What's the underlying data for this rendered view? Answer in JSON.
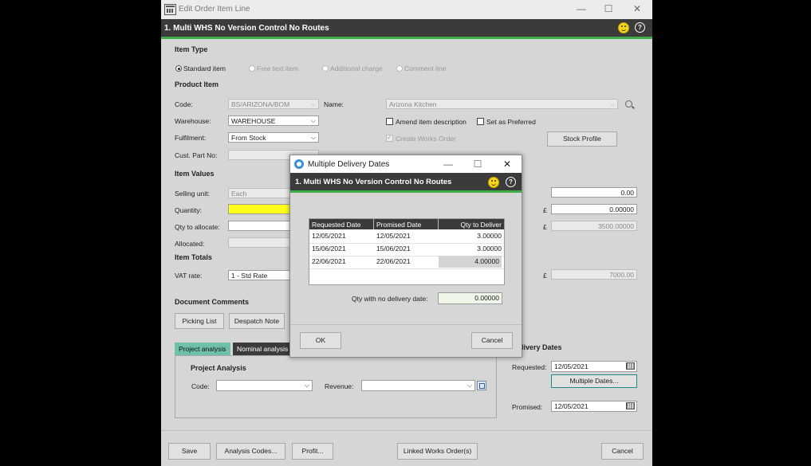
{
  "window": {
    "title": "Edit Order Item Line",
    "header": "1. Multi WHS No Version Control No Routes"
  },
  "item_type": {
    "section": "Item Type",
    "options": [
      "Standard item",
      "Free text item",
      "Additional charge",
      "Comment line"
    ]
  },
  "product_item": {
    "section": "Product Item",
    "code_label": "Code:",
    "code_value": "BS/ARIZONA/BOM",
    "name_label": "Name:",
    "name_value": "Arizona Kitchen",
    "warehouse_label": "Warehouse:",
    "warehouse_value": "WAREHOUSE",
    "fulfilment_label": "Fulfilment:",
    "fulfilment_value": "From Stock",
    "cust_part_label": "Cust. Part No:",
    "amend_label": "Amend item description",
    "preferred_label": "Set as Preferred",
    "works_order_label": "Create Works Order",
    "stock_profile_button": "Stock Profile"
  },
  "item_values": {
    "section": "Item Values",
    "selling_unit_label": "Selling unit:",
    "selling_unit_value": "Each",
    "quantity_label": "Quantity:",
    "qty_allocate_label": "Qty to allocate:",
    "allocated_label": "Allocated:",
    "currency": "£",
    "right_value_1": "0.00",
    "right_value_2": "0.00000",
    "right_value_3": "3500.00000"
  },
  "item_totals": {
    "section": "Item Totals",
    "vat_label": "VAT rate:",
    "vat_value": "1 - Std Rate",
    "total_value": "7000.00"
  },
  "document_comments": {
    "section": "Document Comments",
    "picking_button": "Picking List",
    "despatch_button": "Despatch Note"
  },
  "analysis": {
    "tabs": [
      "Project analysis",
      "Nominal analysis"
    ],
    "section": "Project Analysis",
    "code_label": "Code:",
    "revenue_label": "Revenue:"
  },
  "delivery_dates": {
    "section_partial": "livery Dates",
    "requested_label": "Requested:",
    "requested_value": "12/05/2021",
    "multiple_button": "Multiple Dates...",
    "promised_label": "Promised:",
    "promised_value": "12/05/2021"
  },
  "footer": {
    "save": "Save",
    "analysis_codes": "Analysis Codes...",
    "profit": "Profit...",
    "linked_works": "Linked Works Order(s)",
    "cancel": "Cancel"
  },
  "modal": {
    "title": "Multiple Delivery Dates",
    "header": "1. Multi WHS No Version Control No Routes",
    "columns": [
      "Requested Date",
      "Promised Date",
      "Qty to Deliver"
    ],
    "rows": [
      {
        "requested": "12/05/2021",
        "promised": "12/05/2021",
        "qty": "3.00000"
      },
      {
        "requested": "15/06/2021",
        "promised": "15/06/2021",
        "qty": "3.00000"
      },
      {
        "requested": "22/06/2021",
        "promised": "22/06/2021",
        "qty": "4.00000"
      }
    ],
    "no_date_label": "Qty with no delivery date:",
    "no_date_value": "0.00000",
    "ok": "OK",
    "cancel": "Cancel"
  },
  "colors": {
    "accent_green": "#3fae49",
    "header_dark": "#3b3b3b",
    "tab_active": "#6fbfaa",
    "quantity_highlight": "#ffff1a"
  }
}
